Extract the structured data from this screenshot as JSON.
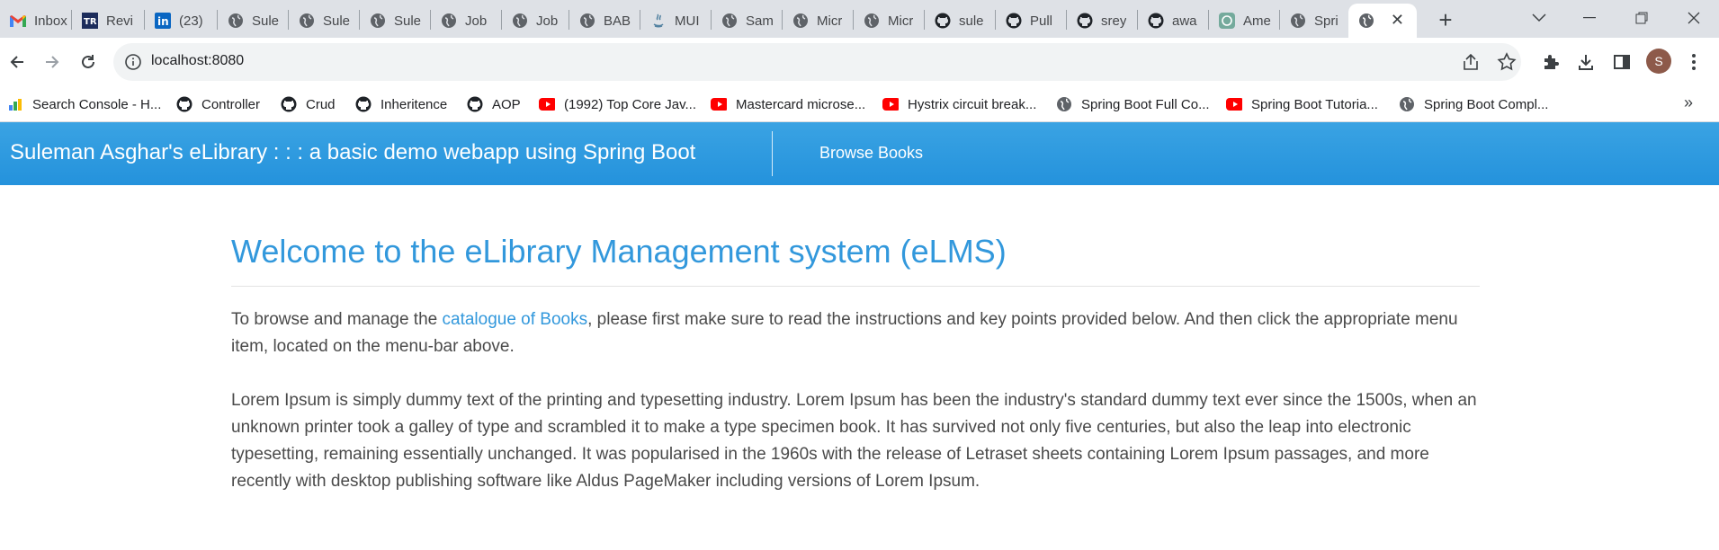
{
  "tabs": [
    {
      "title": "Inbox",
      "icon": "gmail-icon"
    },
    {
      "title": "Revi",
      "icon": "tr-icon"
    },
    {
      "title": "(23)",
      "icon": "linkedin-icon"
    },
    {
      "title": "Sule",
      "icon": "globe-icon"
    },
    {
      "title": "Sule",
      "icon": "globe-icon"
    },
    {
      "title": "Sule",
      "icon": "globe-icon"
    },
    {
      "title": "Job",
      "icon": "globe-icon"
    },
    {
      "title": "Job",
      "icon": "globe-icon"
    },
    {
      "title": "BAB",
      "icon": "globe-icon"
    },
    {
      "title": "MUI",
      "icon": "java-icon"
    },
    {
      "title": "Sam",
      "icon": "globe-icon"
    },
    {
      "title": "Micr",
      "icon": "globe-icon"
    },
    {
      "title": "Micr",
      "icon": "globe-icon"
    },
    {
      "title": "sule",
      "icon": "github-icon"
    },
    {
      "title": "Pull",
      "icon": "github-icon"
    },
    {
      "title": "srey",
      "icon": "github-icon"
    },
    {
      "title": "awa",
      "icon": "github-icon"
    },
    {
      "title": "Ame",
      "icon": "chatgpt-icon"
    },
    {
      "title": "Spri",
      "icon": "globe-icon"
    }
  ],
  "address_bar": {
    "url": "localhost:8080",
    "avatar_letter": "S"
  },
  "bookmarks": [
    {
      "label": "Search Console - H...",
      "icon": "search-console-icon"
    },
    {
      "label": "Controller",
      "icon": "github-icon"
    },
    {
      "label": "Crud",
      "icon": "github-icon"
    },
    {
      "label": "Inheritence",
      "icon": "github-icon"
    },
    {
      "label": "AOP",
      "icon": "github-icon"
    },
    {
      "label": "(1992) Top Core Jav...",
      "icon": "youtube-icon"
    },
    {
      "label": "Mastercard microse...",
      "icon": "youtube-icon"
    },
    {
      "label": "Hystrix circuit break...",
      "icon": "youtube-icon"
    },
    {
      "label": "Spring Boot Full Co...",
      "icon": "globe-icon"
    },
    {
      "label": "Spring Boot Tutoria...",
      "icon": "youtube-icon"
    },
    {
      "label": "Spring Boot Compl...",
      "icon": "globe-icon"
    }
  ],
  "app": {
    "brand": "Suleman Asghar's eLibrary : : : a basic demo webapp using Spring Boot",
    "nav_browse": "Browse Books",
    "heading": "Welcome to the eLibrary Management system (eLMS)",
    "intro_before": "To browse and manage the ",
    "intro_link": "catalogue of Books",
    "intro_after": ", please first make sure to read the instructions and key points provided below. And then click the appropriate menu item, located on the menu-bar above.",
    "lorem": "Lorem Ipsum is simply dummy text of the printing and typesetting industry. Lorem Ipsum has been the industry's standard dummy text ever since the 1500s, when an unknown printer took a galley of type and scrambled it to make a type specimen book. It has survived not only five centuries, but also the leap into electronic typesetting, remaining essentially unchanged. It was popularised in the 1960s with the release of Letraset sheets containing Lorem Ipsum passages, and more recently with desktop publishing software like Aldus PageMaker including versions of Lorem Ipsum."
  },
  "colors": {
    "appbar": "#2492dc",
    "heading": "#3298dc",
    "link": "#3298dc",
    "body_text": "#4a4a4a"
  }
}
